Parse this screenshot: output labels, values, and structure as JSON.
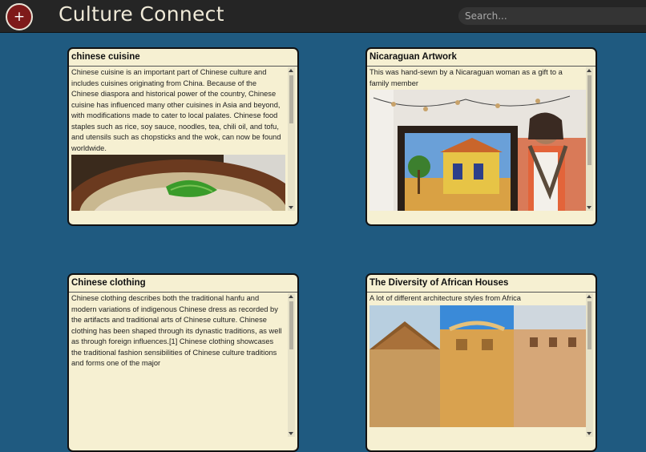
{
  "header": {
    "add_label": "+",
    "title": "Culture Connect",
    "search_placeholder": "Search..."
  },
  "posts": [
    {
      "title": "chinese cuisine",
      "text": "Chinese cuisine is an important part of Chinese culture and includes cuisines originating from China. Because of the Chinese diaspora and historical power of the country, Chinese cuisine has influenced many other cuisines in Asia and beyond, with modifications made to cater to local palates. Chinese food staples such as rice, soy sauce, noodles, tea, chili oil, and tofu, and utensils such as chopsticks and the wok, can now be found worldwide."
    },
    {
      "title": "Nicaraguan Artwork",
      "text": "This was hand-sewn by a Nicaraguan woman as a gift to a family member"
    },
    {
      "title": "Chinese clothing",
      "text": "Chinese clothing describes both the traditional hanfu and modern variations of indigenous Chinese dress as recorded by the artifacts and traditional arts of Chinese culture. Chinese clothing has been shaped through its dynastic traditions, as well as through foreign influences.[1] Chinese clothing showcases the traditional fashion sensibilities of Chinese culture traditions and forms one of the major"
    },
    {
      "title": "The Diversity of African Houses",
      "text": "A lot of different architecture styles from Africa"
    }
  ],
  "colors": {
    "background": "#1f5a80",
    "topbar": "#252525",
    "add_button": "#7e1a1a",
    "card": "#f6f0d2"
  }
}
